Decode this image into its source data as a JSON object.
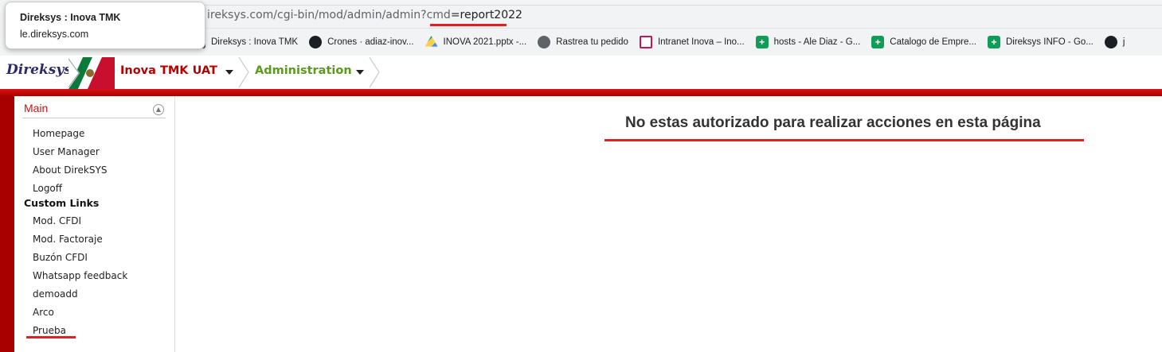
{
  "tooltip": {
    "title": "Direksys : Inova TMK",
    "host": "le.direksys.com"
  },
  "address_bar": {
    "url_prefix": "ireksys.com/cgi-bin/mod/admin/admin?cmd",
    "url_highlight": "=report2022"
  },
  "bookmarks": [
    {
      "label": "Direksys : Inova TMK",
      "icon": "direksys-icon"
    },
    {
      "label": "Crones · adiaz-inov...",
      "icon": "github-icon"
    },
    {
      "label": "INOVA 2021.pptx -...",
      "icon": "drive-icon"
    },
    {
      "label": "Rastrea tu pedido",
      "icon": "globe-icon"
    },
    {
      "label": "Intranet Inova – Ino...",
      "icon": "intranet-icon"
    },
    {
      "label": "hosts - Ale Diaz - G...",
      "icon": "sheets-icon"
    },
    {
      "label": "Catalogo de Empre...",
      "icon": "sheets-icon"
    },
    {
      "label": "Direksys INFO - Go...",
      "icon": "sheets-icon"
    },
    {
      "label": "j",
      "icon": "github-icon"
    }
  ],
  "app_header": {
    "logo_text": "Direksys",
    "breadcrumb_company": "Inova TMK UAT",
    "breadcrumb_section": "Administration"
  },
  "sidebar": {
    "main_header": "Main",
    "main_items": [
      "Homepage",
      "User Manager",
      "About DirekSYS",
      "Logoff"
    ],
    "custom_links_header": "Custom Links",
    "custom_items": [
      "Mod. CFDI",
      "Mod. Factoraje",
      "Buzón CFDI",
      "Whatsapp feedback",
      "demoadd",
      "Arco",
      "Prueba"
    ]
  },
  "content": {
    "message": "No estas autorizado para realizar acciones en esta página"
  },
  "colors": {
    "brand_red": "#a80000",
    "accent_red": "#e02020",
    "section_green": "#5a9a1e"
  }
}
